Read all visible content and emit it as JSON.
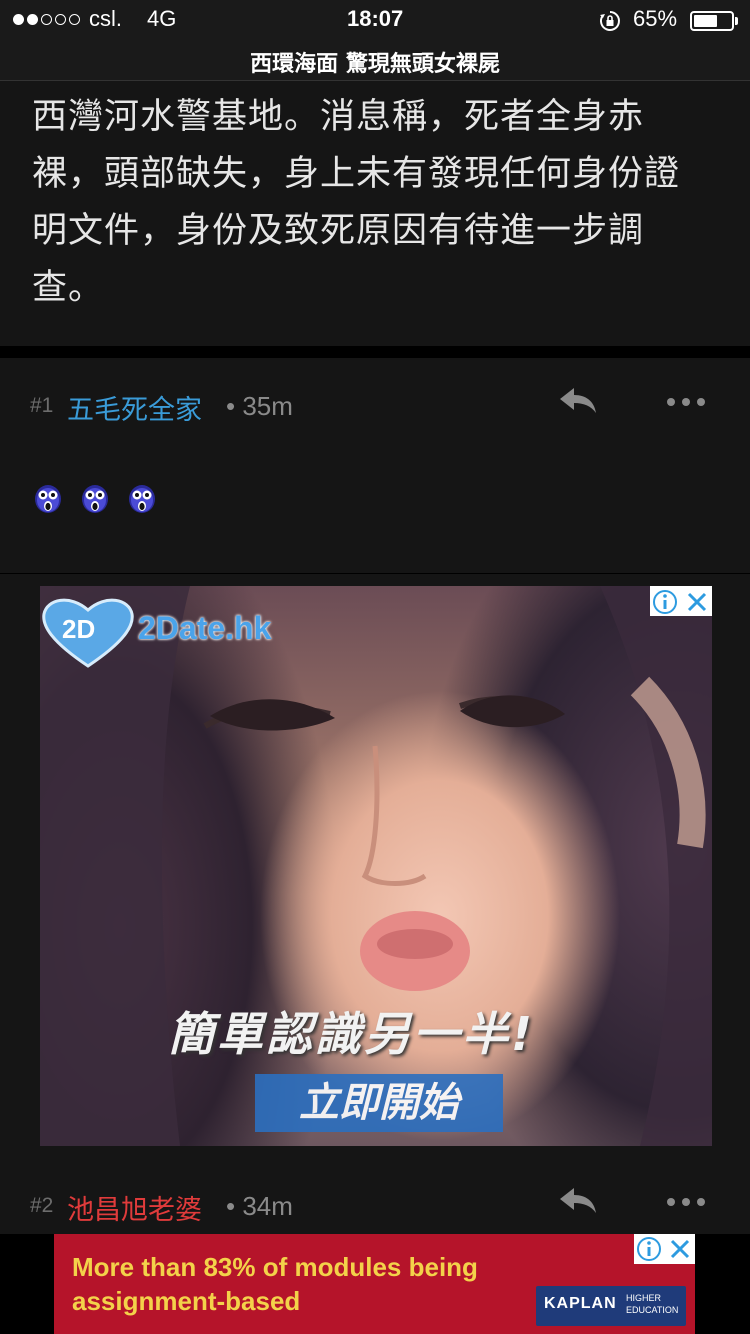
{
  "status_bar": {
    "carrier": "csl.",
    "network": "4G",
    "time": "18:07",
    "battery": "65%",
    "battery_level": 0.65,
    "signal_bars_filled": 2,
    "signal_bars_total": 5
  },
  "header": {
    "title": "西環海面 驚現無頭女裸屍"
  },
  "article": {
    "line1": "西灣河水警基地。消息稱，死者全身赤",
    "line2": "裸，頭部缺失，身上未有發現任何身份證",
    "line3": "明文件，身份及致死原因有待進一步調",
    "line4": "查。"
  },
  "replies": [
    {
      "number": "#1",
      "username": "五毛死全家",
      "time": "• 35m",
      "user_color": "#3a9bd8"
    },
    {
      "number": "#2",
      "username": "池昌旭老婆",
      "time": "• 34m",
      "user_color": "#e03b3b"
    }
  ],
  "ads": {
    "dating": {
      "logo_badge": "2D",
      "logo_text": "2Date.hk",
      "headline": "簡單認識另一半!",
      "cta": "立即開始"
    },
    "banner": {
      "line1": "More than 83% of modules being",
      "line2": "assignment-based",
      "brand": "KAPLAN",
      "brand_sub1": "HIGHER",
      "brand_sub2": "EDUCATION"
    }
  },
  "colors": {
    "background": "#000000",
    "panel": "#151515",
    "text": "#e6e6e6",
    "meta": "#8a8a8a"
  },
  "icons": {
    "reply": "reply-arrow-icon",
    "more": "more-dots-icon",
    "ad_info": "info-icon",
    "ad_close": "close-icon",
    "emoji": "scared-face-emoji"
  }
}
